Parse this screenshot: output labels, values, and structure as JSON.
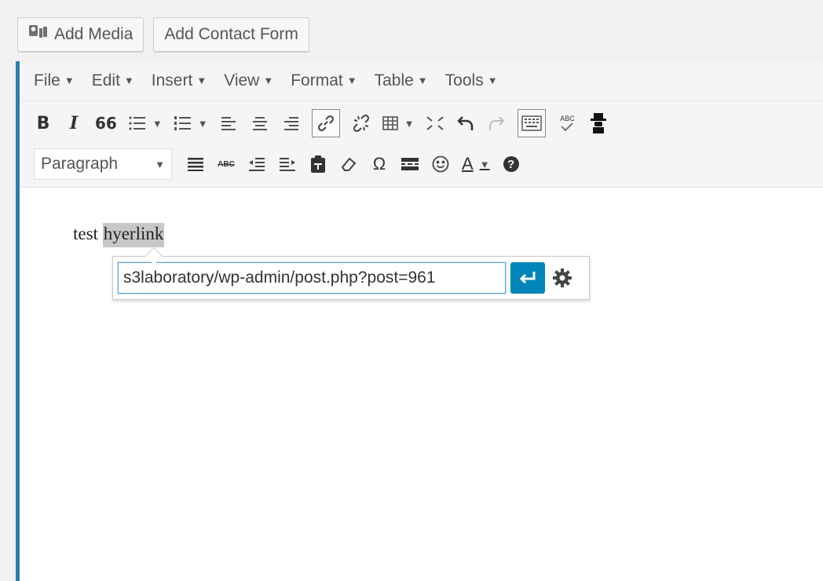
{
  "media_buttons": {
    "add_media": "Add Media",
    "add_contact_form": "Add Contact Form"
  },
  "menubar": [
    {
      "label": "File",
      "caret": "▼"
    },
    {
      "label": "Edit",
      "caret": "▼"
    },
    {
      "label": "Insert",
      "caret": "▼"
    },
    {
      "label": "View",
      "caret": "▼"
    },
    {
      "label": "Format",
      "caret": "▼"
    },
    {
      "label": "Table",
      "caret": "▼"
    },
    {
      "label": "Tools",
      "caret": "▼"
    }
  ],
  "toolbar": {
    "bold": "B",
    "italic": "I",
    "blockquote": "66",
    "dropdown_caret": "▼",
    "paragraph_select": "Paragraph",
    "strikethrough": "ABC",
    "special_char": "Ω",
    "text_color": "A",
    "help": "?",
    "spellcheck": "ABC"
  },
  "editor": {
    "text_before": "test ",
    "selected_text": "hyerlink"
  },
  "link_popup": {
    "url_value": "s3laboratory/wp-admin/post.php?post=961"
  },
  "colors": {
    "accent": "#0085ba",
    "editor_border": "#2a7fb0"
  }
}
